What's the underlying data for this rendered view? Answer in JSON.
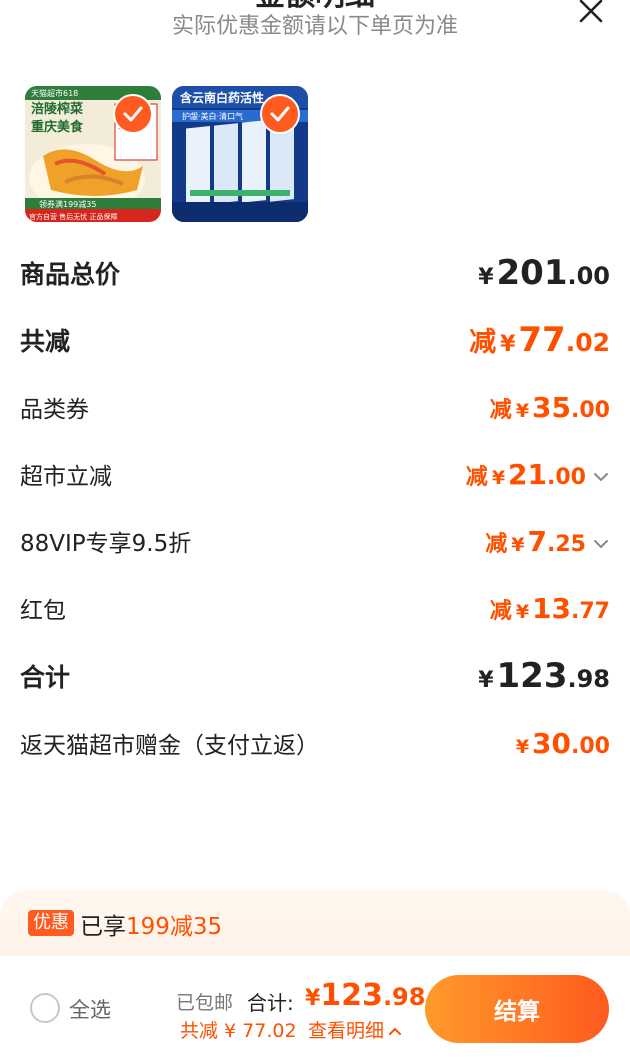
{
  "header": {
    "title": "金额明细",
    "subtitle": "实际优惠金额请以下单页为准"
  },
  "products": [
    {
      "banner": "天猫超市618",
      "line1": "涪陵榨菜",
      "line2": "重庆美食",
      "pack": "涪陵",
      "coupon": "领券满199减35",
      "footer": "官方自营 售后无忧 正品保障"
    },
    {
      "banner": "含云南白药活性",
      "tagline": "护龈·美白·清口气"
    }
  ],
  "rows": {
    "goods_total": {
      "label": "商品总价",
      "yen": "¥",
      "int": "201",
      "dec": ".00"
    },
    "total_reduce": {
      "label": "共减",
      "prefix": "减",
      "yen": "¥",
      "int": "77",
      "dec": ".02"
    },
    "category_coupon": {
      "label": "品类券",
      "prefix": "减",
      "yen": "¥",
      "int": "35",
      "dec": ".00"
    },
    "market_instant": {
      "label": "超市立减",
      "prefix": "减",
      "yen": "¥",
      "int": "21",
      "dec": ".00"
    },
    "vip": {
      "label": "88VIP专享9.5折",
      "prefix": "减",
      "yen": "¥",
      "int": "7",
      "dec": ".25"
    },
    "red_packet": {
      "label": "红包",
      "prefix": "减",
      "yen": "¥",
      "int": "13",
      "dec": ".77"
    },
    "sum": {
      "label": "合计",
      "yen": "¥",
      "int": "123",
      "dec": ".98"
    },
    "cashback": {
      "label": "返天猫超市赠金（支付立返）",
      "yen": "¥",
      "int": "30",
      "dec": ".00"
    }
  },
  "promo": {
    "tag": "优惠",
    "text": "已享",
    "highlight": "199减35"
  },
  "bottom_bar": {
    "select_all": "全选",
    "shipping": "已包邮",
    "total_label": "合计:",
    "total_yen": "¥",
    "total_int": "123",
    "total_dec": ".98",
    "reduce_text": "共减 ¥ 77.02",
    "detail_link": "查看明细",
    "checkout_label": "结算"
  },
  "colors": {
    "accent": "#ff5000",
    "checkout_start": "#ff9a2a",
    "checkout_end": "#ff5a1f"
  }
}
